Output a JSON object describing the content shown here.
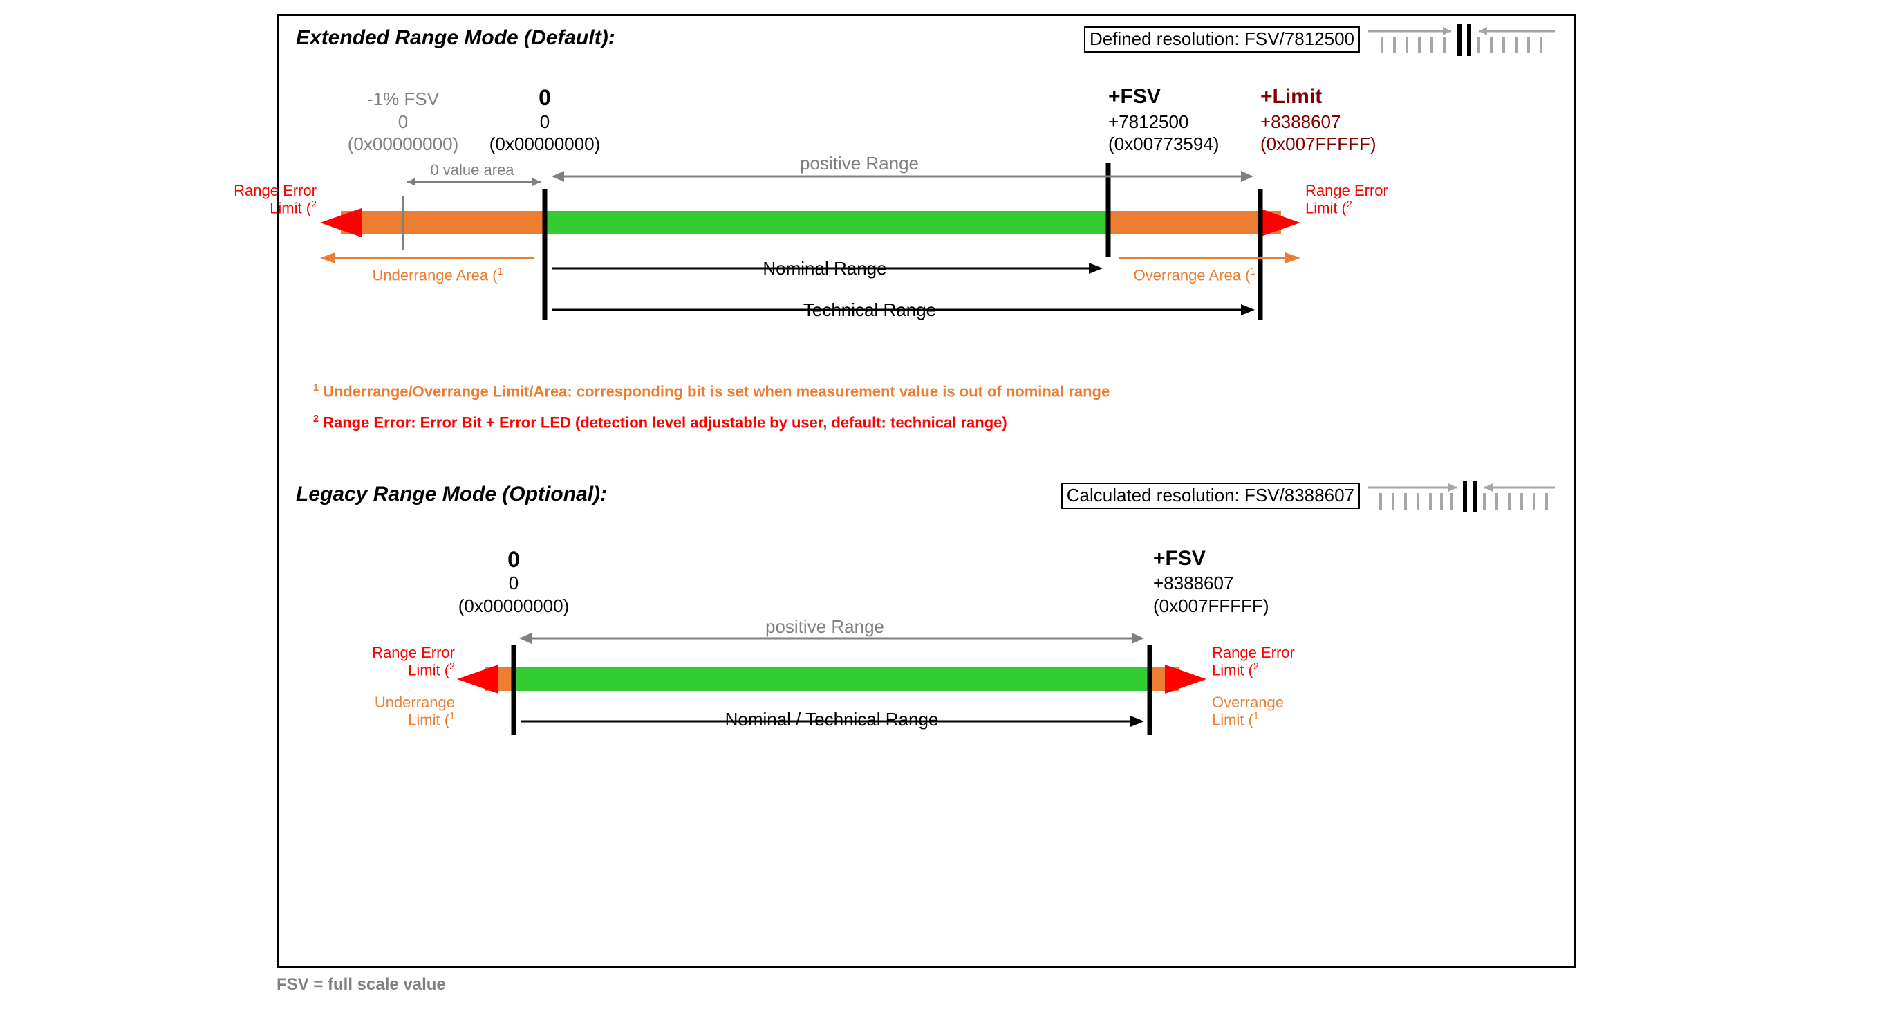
{
  "extended": {
    "title": "Extended Range Mode (Default):",
    "resolution_box": "Defined resolution: FSV/7812500",
    "markers": {
      "m1_pct": "-1% FSV",
      "m1_val": "0",
      "m1_hex": "(0x00000000)",
      "m0_lab": "0",
      "m0_val": "0",
      "m0_hex": "(0x00000000)",
      "fsv_lab": "+FSV",
      "fsv_val": "+7812500",
      "fsv_hex": "(0x00773594)",
      "lim_lab": "+Limit",
      "lim_val": "+8388607",
      "lim_hex": "(0x007FFFFF)"
    },
    "labels": {
      "range_error_limit": "Range Error",
      "range_error_limit2": "Limit (",
      "underrange_area": "Underrange Area (",
      "overrange_area": "Overrange Area (",
      "zero_value_area": "0 value area",
      "positive_range": "positive Range",
      "nominal_range": "Nominal Range",
      "technical_range": "Technical Range"
    }
  },
  "legacy": {
    "title": "Legacy Range Mode (Optional):",
    "resolution_box": "Calculated resolution: FSV/8388607",
    "markers": {
      "m0_lab": "0",
      "m0_val": "0",
      "m0_hex": "(0x00000000)",
      "fsv_lab": "+FSV",
      "fsv_val": "+8388607",
      "fsv_hex": "(0x007FFFFF)"
    },
    "labels": {
      "range_error_limit": "Range Error",
      "range_error_limit2": "Limit (",
      "underrange_limit": "Underrange",
      "underrange_limit2": "Limit (",
      "overrange_limit": "Overrange",
      "overrange_limit2": "Limit (",
      "positive_range": "positive Range",
      "nominal_technical_range": "Nominal / Technical Range"
    }
  },
  "footnotes": {
    "f1": "Underrange/Overrange Limit/Area: corresponding bit is set when measurement value is out of nominal range",
    "f2": "Range Error: Error Bit + Error LED (detection level adjustable by user, default: technical range)"
  },
  "caption": "FSV = full scale value",
  "super": {
    "one": "1",
    "two": "2"
  }
}
